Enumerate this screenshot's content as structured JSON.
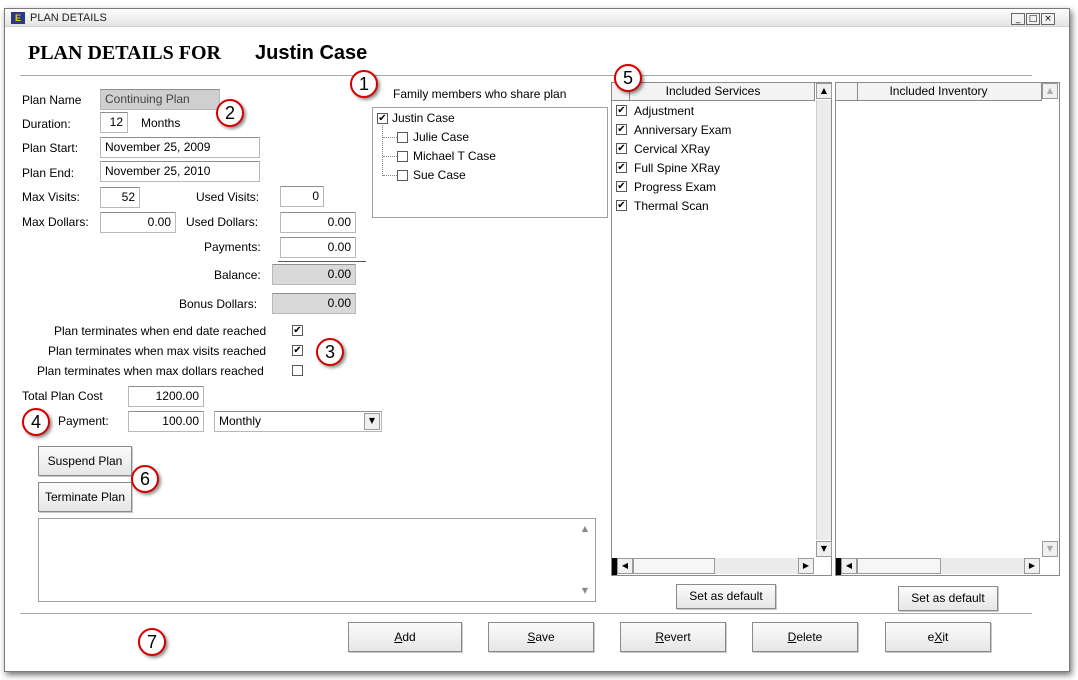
{
  "window": {
    "title": "PLAN DETAILS",
    "icon": "app-icon",
    "min_glyph": "_",
    "max_glyph": "□",
    "close_glyph": "×"
  },
  "header": {
    "label": "PLAN DETAILS FOR",
    "patient": "Justin Case"
  },
  "form": {
    "plan_name_label": "Plan Name",
    "plan_name": "Continuing Plan",
    "duration_label": "Duration:",
    "duration": "12",
    "duration_unit": "Months",
    "plan_start_label": "Plan Start:",
    "plan_start": "November 25, 2009",
    "plan_end_label": "Plan End:",
    "plan_end": "November 25, 2010",
    "max_visits_label": "Max Visits:",
    "max_visits": "52",
    "used_visits_label": "Used Visits:",
    "used_visits": "0",
    "max_dollars_label": "Max Dollars:",
    "max_dollars": "0.00",
    "used_dollars_label": "Used Dollars:",
    "used_dollars": "0.00",
    "payments_label": "Payments:",
    "payments": "0.00",
    "balance_label": "Balance:",
    "balance": "0.00",
    "bonus_label": "Bonus Dollars:",
    "bonus": "0.00"
  },
  "terminate_options": [
    {
      "label": "Plan terminates when end date reached",
      "checked": true
    },
    {
      "label": "Plan terminates when max visits reached",
      "checked": true
    },
    {
      "label": "Plan terminates when max dollars reached",
      "checked": false
    }
  ],
  "cost": {
    "total_label": "Total Plan Cost",
    "total": "1200.00",
    "payment_label": "Payment:",
    "payment": "100.00",
    "frequency": "Monthly"
  },
  "actions": {
    "suspend": "Suspend Plan",
    "terminate": "Terminate Plan"
  },
  "family": {
    "header": "Family members who share plan",
    "root": {
      "name": "Justin Case",
      "checked": true
    },
    "children": [
      {
        "name": "Julie Case",
        "checked": false
      },
      {
        "name": "Michael T Case",
        "checked": false
      },
      {
        "name": "Sue Case",
        "checked": false
      }
    ]
  },
  "services": {
    "header": "Included Services",
    "items": [
      "Adjustment",
      "Anniversary Exam",
      "Cervical XRay",
      "Full Spine XRay",
      "Progress Exam",
      "Thermal Scan"
    ],
    "default_label": "Set as default"
  },
  "inventory": {
    "header": "Included Inventory",
    "default_label": "Set as default"
  },
  "footer": {
    "add": "Add",
    "add_key": "A",
    "add_rest": "dd",
    "save_key": "S",
    "save_rest": "ave",
    "revert_key": "R",
    "revert_rest": "evert",
    "delete_key": "D",
    "delete_rest": "elete",
    "exit_pre": "e",
    "exit_key": "X",
    "exit_rest": "it"
  },
  "callouts": [
    "1",
    "2",
    "3",
    "4",
    "5",
    "6",
    "7"
  ],
  "glyphs": {
    "check": "✔",
    "up": "▲",
    "down": "▼",
    "left": "◀",
    "right": "▶"
  }
}
